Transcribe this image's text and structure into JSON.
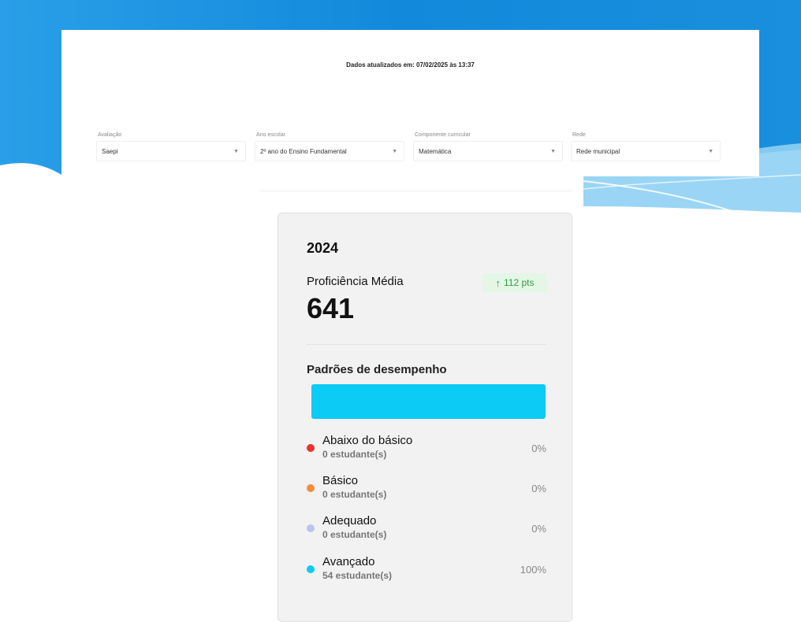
{
  "header": {
    "updated_text": "Dados atualizados em: 07/02/2025 às 13:37"
  },
  "filters": [
    {
      "label": "Avaliação",
      "value": "Saepi"
    },
    {
      "label": "Ano escolar",
      "value": "2º ano do Ensino Fundamental"
    },
    {
      "label": "Componente curricular",
      "value": "Matemática"
    },
    {
      "label": "Rede",
      "value": "Rede municipal"
    }
  ],
  "card": {
    "year": "2024",
    "proficiency_label": "Proficiência Média",
    "proficiency_value": "641",
    "delta_badge": "112 pts",
    "standards_title": "Padrões de desempenho",
    "levels": [
      {
        "name": "Abaixo do básico",
        "count": "0 estudante(s)",
        "percent_text": "0%",
        "percent": 0,
        "color": "#e8312f"
      },
      {
        "name": "Básico",
        "count": "0 estudante(s)",
        "percent_text": "0%",
        "percent": 0,
        "color": "#f58c3c"
      },
      {
        "name": "Adequado",
        "count": "0 estudante(s)",
        "percent_text": "0%",
        "percent": 0,
        "color": "#b9c6ea"
      },
      {
        "name": "Avançado",
        "count": "54 estudante(s)",
        "percent_text": "100%",
        "percent": 100,
        "color": "#0ccbf5"
      }
    ]
  },
  "colors": {
    "brand_blue": "#1d8fdc",
    "positive_green": "#2e9e42"
  },
  "icons": {
    "badge": "arrow-up-icon",
    "dropdown": "chevron-down-icon"
  }
}
